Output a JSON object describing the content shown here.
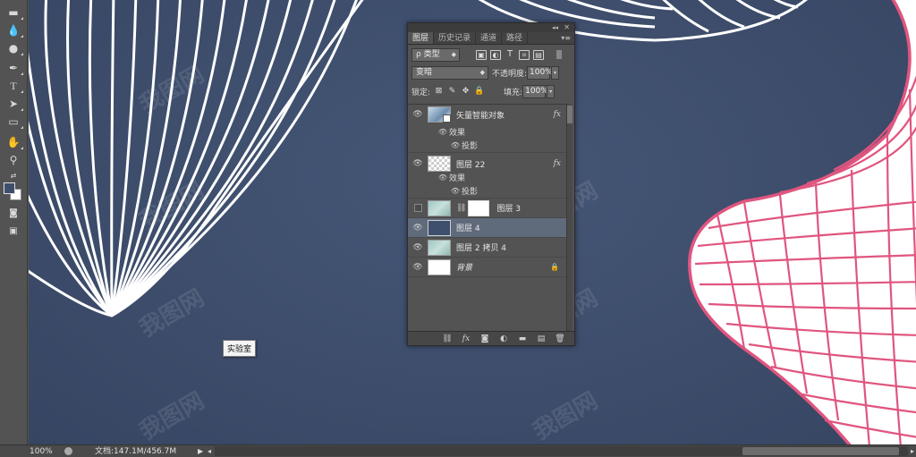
{
  "toolbar": {
    "tools": [
      {
        "name": "gradient-tool",
        "icon": "▬"
      },
      {
        "name": "blur-tool",
        "icon": "●"
      },
      {
        "name": "dodge-tool",
        "icon": "🔍"
      },
      {
        "name": "pen-tool",
        "icon": "✒"
      },
      {
        "name": "type-tool",
        "icon": "T"
      },
      {
        "name": "path-selection-tool",
        "icon": "➤"
      },
      {
        "name": "rectangle-tool",
        "icon": "▭"
      },
      {
        "name": "hand-tool",
        "icon": "✋"
      },
      {
        "name": "zoom-tool",
        "icon": "🔎"
      }
    ],
    "foreground_color": "#3e4e6d",
    "background_color": "#ffffff"
  },
  "canvas": {
    "background_color": "#3e4e6d",
    "tooltip": "实验室",
    "watermark": "我图网"
  },
  "layers_panel": {
    "tabs": [
      "图层",
      "历史记录",
      "通道",
      "路径"
    ],
    "filter_label": "ρ 类型",
    "blend_mode": "变暗",
    "opacity_label": "不透明度:",
    "opacity_value": "100%",
    "lock_label": "锁定:",
    "fill_label": "填充:",
    "fill_value": "100%",
    "layers": [
      {
        "name": "矢量智能对象",
        "thumb": "smart",
        "visible": true,
        "fx": "fx",
        "effects_label": "效果",
        "effect": "投影"
      },
      {
        "name": "图层 22",
        "thumb": "check",
        "visible": true,
        "fx": "fx",
        "effects_label": "效果",
        "effect": "投影"
      },
      {
        "name": "图层 3",
        "thumb": "teal",
        "visible": false,
        "mask": true
      },
      {
        "name": "图层 4",
        "thumb": "blue",
        "visible": true,
        "selected": true
      },
      {
        "name": "图层 2 拷贝 4",
        "thumb": "teal",
        "visible": true
      },
      {
        "name": "背景",
        "thumb": "white",
        "visible": true,
        "locked": true
      }
    ]
  },
  "status_bar": {
    "zoom": "100%",
    "doc_info": "文档:147.1M/456.7M"
  },
  "colors": {
    "pink_stroke": "#e0557f",
    "white_stroke": "#ffffff"
  }
}
